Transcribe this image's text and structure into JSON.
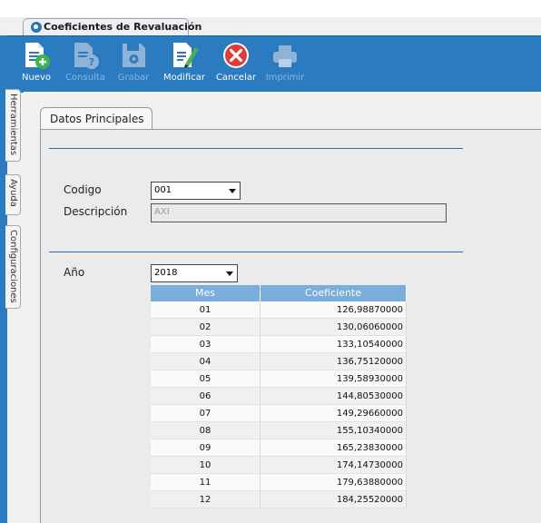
{
  "window": {
    "tab_title": "Coeficientes de Revaluación"
  },
  "toolbar": {
    "buttons": [
      {
        "label": "Nuevo",
        "icon": "new-document-icon",
        "enabled": true
      },
      {
        "label": "Consulta",
        "icon": "query-document-icon",
        "enabled": false
      },
      {
        "label": "Grabar",
        "icon": "save-disk-icon",
        "enabled": false
      },
      {
        "label": "Modificar",
        "icon": "edit-pencil-icon",
        "enabled": true
      },
      {
        "label": "Cancelar",
        "icon": "cancel-x-icon",
        "enabled": true
      },
      {
        "label": "Imprimir",
        "icon": "printer-icon",
        "enabled": false
      }
    ]
  },
  "side_tabs": [
    "Herramientas",
    "Ayuda",
    "Configuraciones"
  ],
  "form": {
    "tab": "Datos Principales",
    "codigo_label": "Codigo",
    "codigo_value": "001",
    "descripcion_label": "Descripción",
    "descripcion_value": "AXI",
    "anio_label": "Año",
    "anio_value": "2018"
  },
  "grid": {
    "columns": [
      "Mes",
      "Coeficiente"
    ],
    "rows": [
      [
        "01",
        "126,98870000"
      ],
      [
        "02",
        "130,06060000"
      ],
      [
        "03",
        "133,10540000"
      ],
      [
        "04",
        "136,75120000"
      ],
      [
        "05",
        "139,58930000"
      ],
      [
        "06",
        "144,80530000"
      ],
      [
        "07",
        "149,29660000"
      ],
      [
        "08",
        "155,10340000"
      ],
      [
        "09",
        "165,23830000"
      ],
      [
        "10",
        "174,14730000"
      ],
      [
        "11",
        "179,63880000"
      ],
      [
        "12",
        "184,25520000"
      ]
    ]
  },
  "colors": {
    "toolbar": "#2a7bc0",
    "grid_header": "#7aaddc",
    "accent_line": "#2a6db0"
  }
}
